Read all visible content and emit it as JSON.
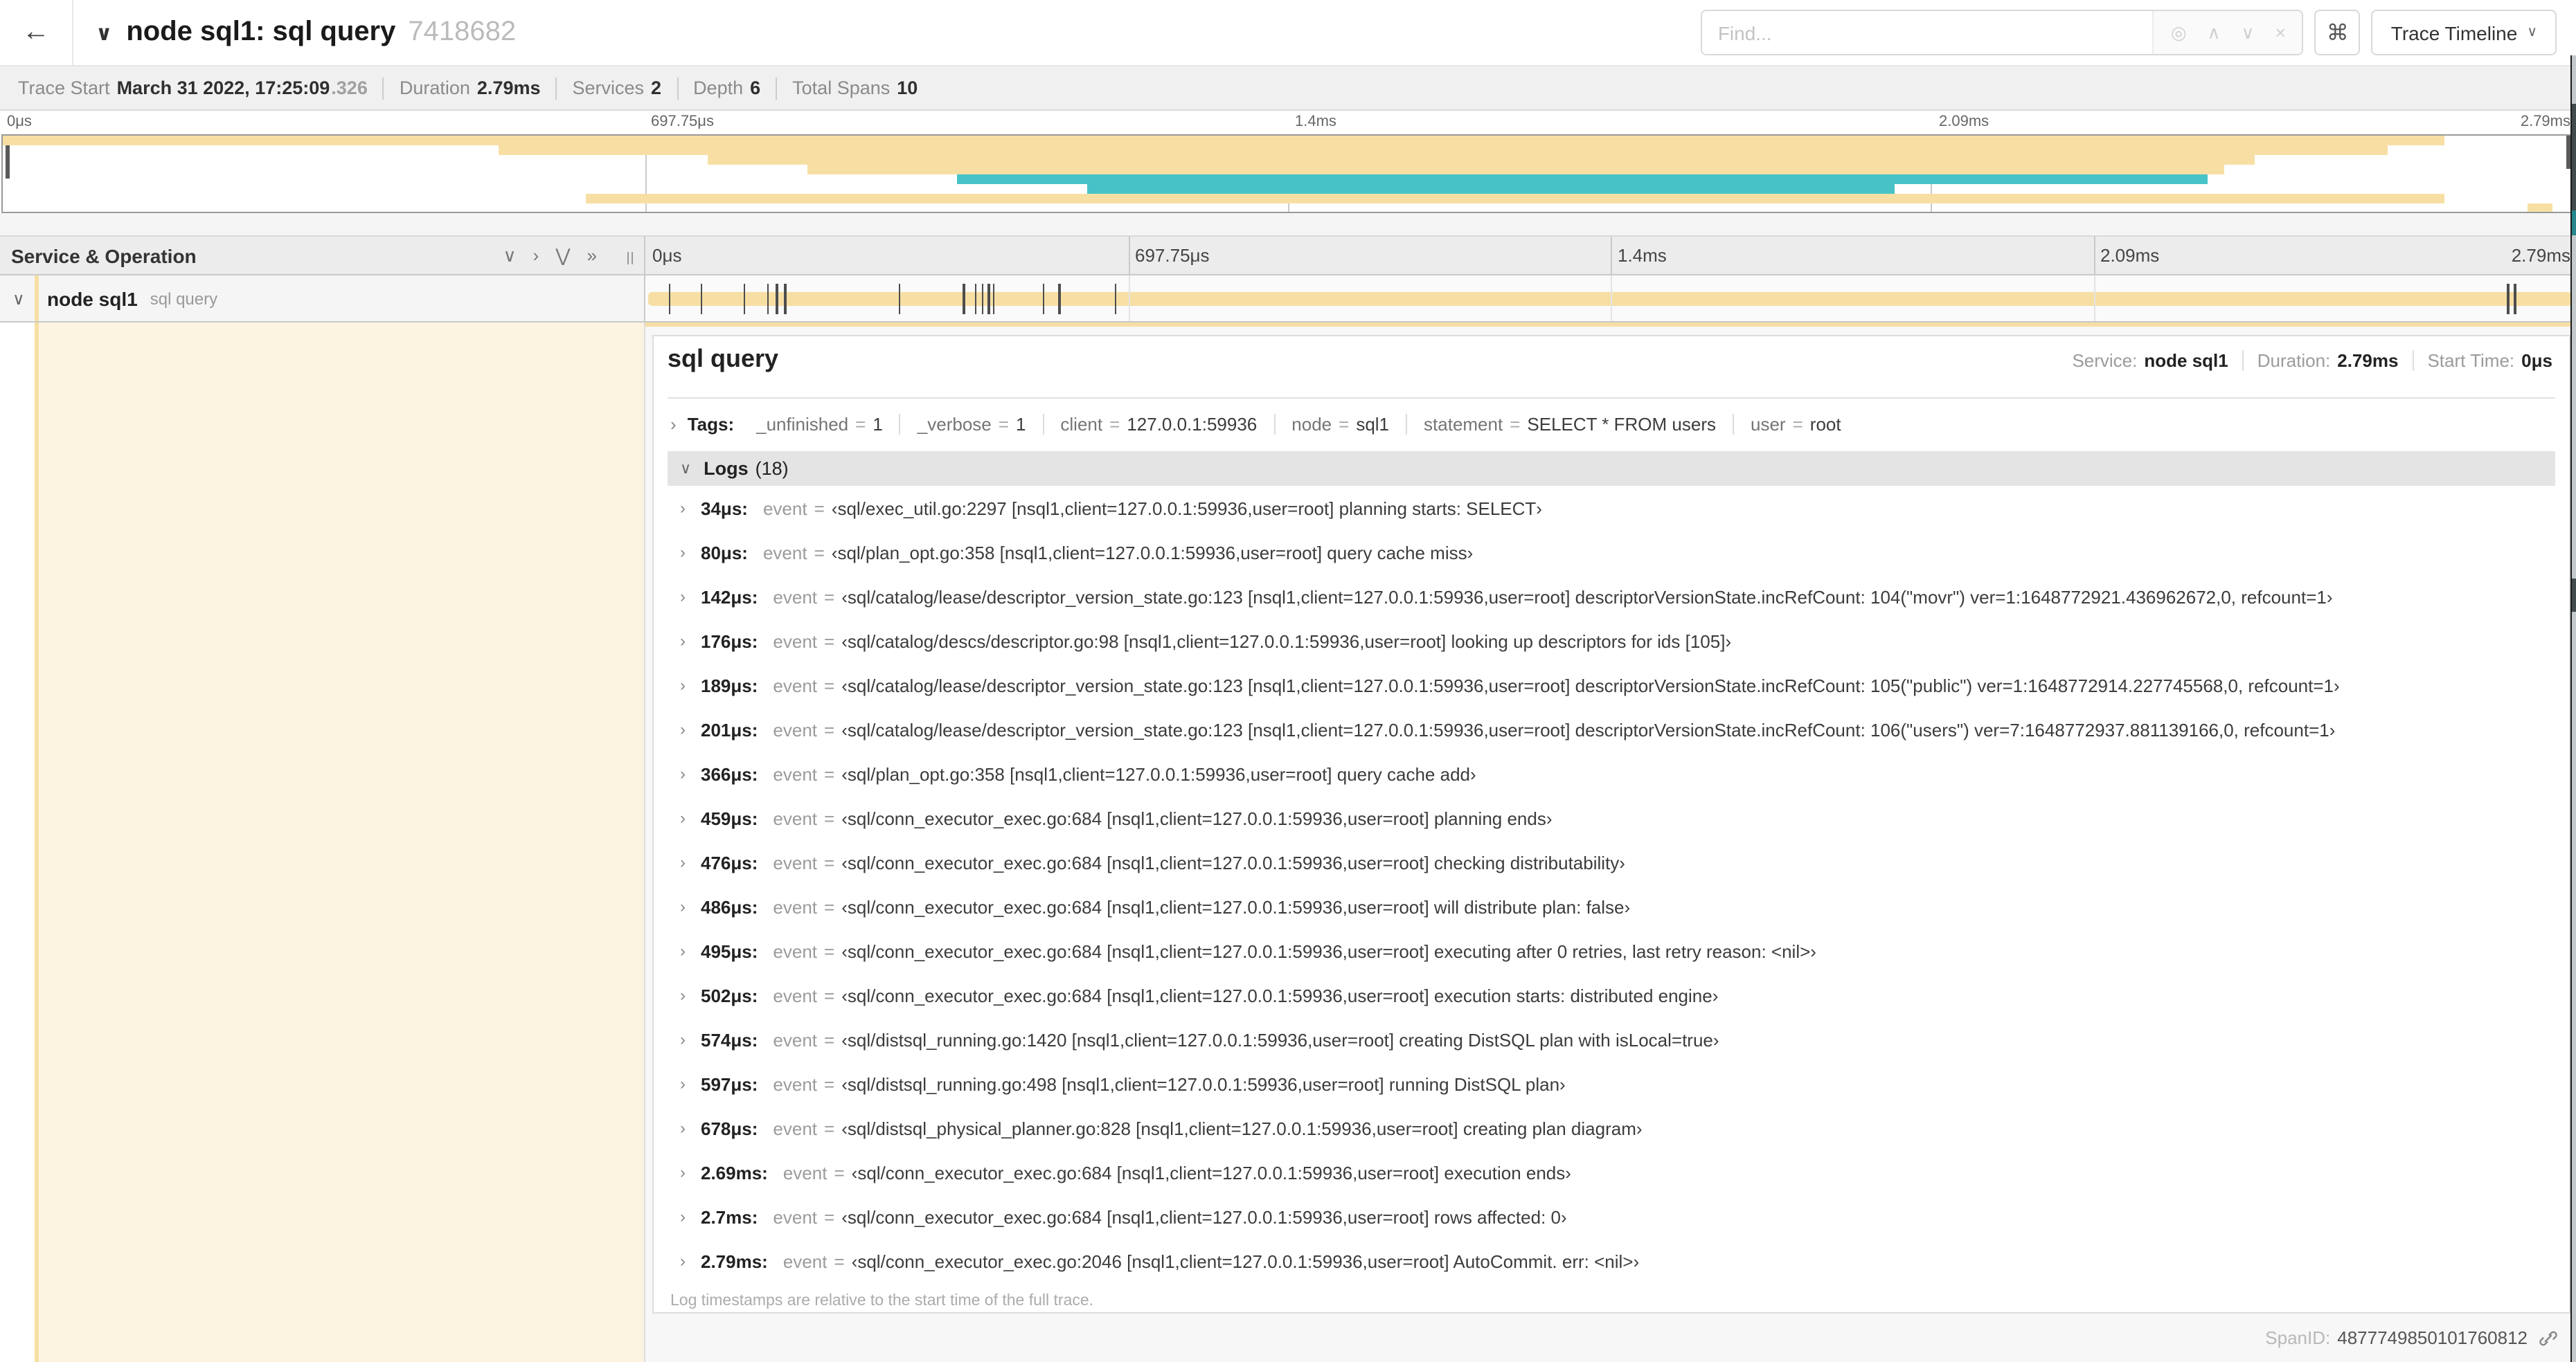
{
  "header": {
    "back": "←",
    "chevron": "∨",
    "title": "node sql1: sql query",
    "trace_id": "7418682",
    "find_placeholder": "Find...",
    "locate_icon": "◎",
    "prev_icon": "∧",
    "next_icon": "∨",
    "clear_icon": "×",
    "shortcut_button": "⌘",
    "view_dropdown": "Trace Timeline",
    "dropdown_chevron": "∨"
  },
  "trace_info": {
    "items": [
      {
        "label": "Trace Start",
        "value": "March 31 2022, 17:25:09",
        "suffix": ".326"
      },
      {
        "label": "Duration",
        "value": "2.79ms"
      },
      {
        "label": "Services",
        "value": "2"
      },
      {
        "label": "Depth",
        "value": "6"
      },
      {
        "label": "Total Spans",
        "value": "10"
      }
    ]
  },
  "trace": {
    "duration_us": 2790
  },
  "minimap": {
    "ticks": [
      {
        "label": "0μs",
        "pos": 0
      },
      {
        "label": "697.75μs",
        "pos": 25
      },
      {
        "label": "1.4ms",
        "pos": 50
      },
      {
        "label": "2.09ms",
        "pos": 75
      },
      {
        "label": "2.79ms",
        "pos": 100
      }
    ],
    "spans": [
      {
        "row": 0,
        "start": 0,
        "end": 95,
        "color": "tan"
      },
      {
        "row": 1,
        "start": 19.3,
        "end": 92.8,
        "color": "tan"
      },
      {
        "row": 2,
        "start": 27.4,
        "end": 87.6,
        "color": "tan"
      },
      {
        "row": 3,
        "start": 31.3,
        "end": 86.4,
        "color": "tan"
      },
      {
        "row": 4,
        "start": 37.1,
        "end": 85.8,
        "color": "teal"
      },
      {
        "row": 5,
        "start": 42.2,
        "end": 73.6,
        "color": "teal"
      },
      {
        "row": 6,
        "start": 22.7,
        "end": 95,
        "color": "tan"
      },
      {
        "row": 7,
        "start": 98.2,
        "end": 99.2,
        "color": "tan"
      }
    ]
  },
  "timeline": {
    "col_header": "Service & Operation",
    "collapse_one_icon": "∨",
    "expand_one_icon": "›",
    "collapse_all_icon": "⋁",
    "expand_all_icon": "»",
    "ticks": [
      {
        "label": "0μs",
        "pos": 0
      },
      {
        "label": "697.75μs",
        "pos": 25
      },
      {
        "label": "1.4ms",
        "pos": 50
      },
      {
        "label": "2.09ms",
        "pos": 75
      },
      {
        "label": "2.79ms",
        "pos": 100
      }
    ],
    "row": {
      "chevron": "∨",
      "service": "node sql1",
      "operation": "sql query"
    }
  },
  "detail": {
    "title": "sql query",
    "meta": [
      {
        "label": "Service:",
        "value": "node sql1"
      },
      {
        "label": "Duration:",
        "value": "2.79ms"
      },
      {
        "label": "Start Time:",
        "value": "0μs"
      }
    ],
    "tags": {
      "chevron": "›",
      "label": "Tags:",
      "items": [
        {
          "key": "_unfinished",
          "value": "1"
        },
        {
          "key": "_verbose",
          "value": "1"
        },
        {
          "key": "client",
          "value": "127.0.0.1:59936"
        },
        {
          "key": "node",
          "value": "sql1"
        },
        {
          "key": "statement",
          "value": "SELECT * FROM users"
        },
        {
          "key": "user",
          "value": "root"
        }
      ]
    },
    "logs": {
      "chevron": "∨",
      "label": "Logs",
      "count": "(18)",
      "entry_chevron": "›",
      "entry_key": "event",
      "entries": [
        {
          "time": "34μs:",
          "t_us": 34,
          "value": "‹sql/exec_util.go:2297 [nsql1,client=127.0.0.1:59936,user=root] planning starts: SELECT›"
        },
        {
          "time": "80μs:",
          "t_us": 80,
          "value": "‹sql/plan_opt.go:358 [nsql1,client=127.0.0.1:59936,user=root] query cache miss›"
        },
        {
          "time": "142μs:",
          "t_us": 142,
          "value": "‹sql/catalog/lease/descriptor_version_state.go:123 [nsql1,client=127.0.0.1:59936,user=root] descriptorVersionState.incRefCount: 104(\"movr\") ver=1:1648772921.436962672,0, refcount=1›"
        },
        {
          "time": "176μs:",
          "t_us": 176,
          "value": "‹sql/catalog/descs/descriptor.go:98 [nsql1,client=127.0.0.1:59936,user=root] looking up descriptors for ids [105]›"
        },
        {
          "time": "189μs:",
          "t_us": 189,
          "value": "‹sql/catalog/lease/descriptor_version_state.go:123 [nsql1,client=127.0.0.1:59936,user=root] descriptorVersionState.incRefCount: 105(\"public\") ver=1:1648772914.227745568,0, refcount=1›"
        },
        {
          "time": "201μs:",
          "t_us": 201,
          "value": "‹sql/catalog/lease/descriptor_version_state.go:123 [nsql1,client=127.0.0.1:59936,user=root] descriptorVersionState.incRefCount: 106(\"users\") ver=7:1648772937.881139166,0, refcount=1›"
        },
        {
          "time": "366μs:",
          "t_us": 366,
          "value": "‹sql/plan_opt.go:358 [nsql1,client=127.0.0.1:59936,user=root] query cache add›"
        },
        {
          "time": "459μs:",
          "t_us": 459,
          "value": "‹sql/conn_executor_exec.go:684 [nsql1,client=127.0.0.1:59936,user=root] planning ends›"
        },
        {
          "time": "476μs:",
          "t_us": 476,
          "value": "‹sql/conn_executor_exec.go:684 [nsql1,client=127.0.0.1:59936,user=root] checking distributability›"
        },
        {
          "time": "486μs:",
          "t_us": 486,
          "value": "‹sql/conn_executor_exec.go:684 [nsql1,client=127.0.0.1:59936,user=root] will distribute plan: false›"
        },
        {
          "time": "495μs:",
          "t_us": 495,
          "value": "‹sql/conn_executor_exec.go:684 [nsql1,client=127.0.0.1:59936,user=root] executing after 0 retries, last retry reason: <nil>›"
        },
        {
          "time": "502μs:",
          "t_us": 502,
          "value": "‹sql/conn_executor_exec.go:684 [nsql1,client=127.0.0.1:59936,user=root] execution starts: distributed engine›"
        },
        {
          "time": "574μs:",
          "t_us": 574,
          "value": "‹sql/distsql_running.go:1420 [nsql1,client=127.0.0.1:59936,user=root] creating DistSQL plan with isLocal=true›"
        },
        {
          "time": "597μs:",
          "t_us": 597,
          "value": "‹sql/distsql_running.go:498 [nsql1,client=127.0.0.1:59936,user=root] running DistSQL plan›"
        },
        {
          "time": "678μs:",
          "t_us": 678,
          "value": "‹sql/distsql_physical_planner.go:828 [nsql1,client=127.0.0.1:59936,user=root] creating plan diagram›"
        },
        {
          "time": "2.69ms:",
          "t_us": 2690,
          "value": "‹sql/conn_executor_exec.go:684 [nsql1,client=127.0.0.1:59936,user=root] execution ends›"
        },
        {
          "time": "2.7ms:",
          "t_us": 2700,
          "value": "‹sql/conn_executor_exec.go:684 [nsql1,client=127.0.0.1:59936,user=root] rows affected: 0›"
        },
        {
          "time": "2.79ms:",
          "t_us": 2790,
          "value": "‹sql/conn_executor_exec.go:2046 [nsql1,client=127.0.0.1:59936,user=root] AutoCommit. err: <nil>›"
        }
      ],
      "note": "Log timestamps are relative to the start time of the full trace."
    },
    "span_id_label": "SpanID:",
    "span_id": "4877749850101760812"
  },
  "colors": {
    "tan": "#f7dfa4",
    "teal": "#47c3c8",
    "cream": "#fcf4e1",
    "accent": "#f7dfa4"
  }
}
